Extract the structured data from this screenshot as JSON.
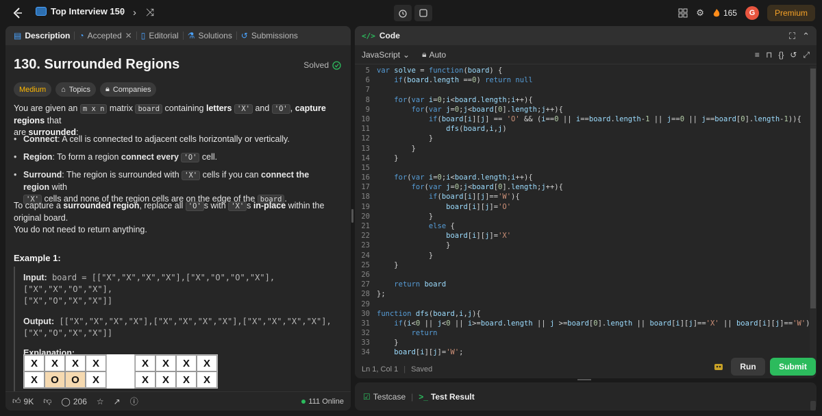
{
  "topbar": {
    "list_title": "Top Interview 150",
    "streak_count": "165",
    "avatar_letter": "G",
    "premium_label": "Premium"
  },
  "left_tabs": [
    {
      "label": "Description"
    },
    {
      "label": "Accepted"
    },
    {
      "label": "Editorial"
    },
    {
      "label": "Solutions"
    },
    {
      "label": "Submissions"
    }
  ],
  "problem": {
    "title": "130. Surrounded Regions",
    "solved_label": "Solved",
    "difficulty": "Medium",
    "topics_label": "Topics",
    "companies_label": "Companies",
    "intro_a": "You are given an ",
    "intro_m": "m x n",
    "intro_b": " matrix ",
    "intro_board": "board",
    "intro_c": " containing ",
    "intro_letters": "letters",
    "intro_x": "'X'",
    "intro_and": " and ",
    "intro_o": "'O'",
    "intro_capture": "capture regions",
    "intro_d": " that",
    "intro_e": "are ",
    "intro_surrounded": "surrounded",
    "bullet1_bold": "Connect",
    "bullet1_text": ": A cell is connected to adjacent cells horizontally or vertically.",
    "bullet2_bold": "Region",
    "bullet2_text_a": ": To form a region ",
    "bullet2_bold2": "connect every",
    "bullet2_code": "'O'",
    "bullet2_text_b": " cell.",
    "bullet3_bold": "Surround",
    "bullet3_text_a": ": The region is surrounded with ",
    "bullet3_code": "'X'",
    "bullet3_text_b": " cells if you can ",
    "bullet3_bold2": "connect the region",
    "bullet3_text_c": " with",
    "bullet3_code2": "'X'",
    "bullet3_text_d": " cells and none of the region cells are on the edge of the ",
    "bullet3_code3": "board",
    "bullet3_text_e": ".",
    "para2_a": "To capture a ",
    "para2_bold": "surrounded region",
    "para2_b": ", replace all ",
    "para2_code": "'O'",
    "para2_c": "s with ",
    "para2_code2": "'X'",
    "para2_d": "s ",
    "para2_bold2": "in-place",
    "para2_e": " within the original board.",
    "para2_f": "You do not need to return anything.",
    "example_title": "Example 1:",
    "input_label": "Input:",
    "input_value_1": " board = [[\"X\",\"X\",\"X\",\"X\"],[\"X\",\"O\",\"O\",\"X\"],[\"X\",\"X\",\"O\",\"X\"],",
    "input_value_2": "[\"X\",\"O\",\"X\",\"X\"]]",
    "output_label": "Output:",
    "output_value_1": " [[\"X\",\"X\",\"X\",\"X\"],[\"X\",\"X\",\"X\",\"X\"],[\"X\",\"X\",\"X\",\"X\"],",
    "output_value_2": "[\"X\",\"O\",\"X\",\"X\"]]",
    "explanation_label": "Explanation:",
    "grid_before": [
      [
        "X",
        "X",
        "X",
        "X"
      ],
      [
        "X",
        "O",
        "O",
        "X"
      ]
    ],
    "grid_after": [
      [
        "X",
        "X",
        "X",
        "X"
      ],
      [
        "X",
        "X",
        "X",
        "X"
      ]
    ]
  },
  "left_footer": {
    "likes": "9K",
    "comments": "206",
    "online": "111 Online"
  },
  "editor": {
    "header_tag": "</>",
    "header_label": "Code",
    "language": "JavaScript",
    "mode": "Auto",
    "status": "Ln 1, Col 1",
    "saved": "Saved",
    "lines": [
      {
        "n": "5",
        "t": "var solve = function(board) {"
      },
      {
        "n": "6",
        "t": "    if(board.length ==0) return null"
      },
      {
        "n": "7",
        "t": ""
      },
      {
        "n": "8",
        "t": "    for(var i=0;i<board.length;i++){"
      },
      {
        "n": "9",
        "t": "        for(var j=0;j<board[0].length;j++){"
      },
      {
        "n": "10",
        "t": "            if(board[i][j] == 'O' && (i==0 || i==board.length-1 || j==0 || j==board[0].length-1)){"
      },
      {
        "n": "11",
        "t": "                dfs(board,i,j)"
      },
      {
        "n": "12",
        "t": "            }"
      },
      {
        "n": "13",
        "t": "        }"
      },
      {
        "n": "14",
        "t": "    }"
      },
      {
        "n": "15",
        "t": ""
      },
      {
        "n": "16",
        "t": "    for(var i=0;i<board.length;i++){"
      },
      {
        "n": "17",
        "t": "        for(var j=0;j<board[0].length;j++){"
      },
      {
        "n": "18",
        "t": "            if(board[i][j]=='W'){"
      },
      {
        "n": "19",
        "t": "                board[i][j]='O'"
      },
      {
        "n": "20",
        "t": "            }"
      },
      {
        "n": "21",
        "t": "            else {"
      },
      {
        "n": "22",
        "t": "                board[i][j]='X'"
      },
      {
        "n": "23",
        "t": "                }"
      },
      {
        "n": "24",
        "t": "            }"
      },
      {
        "n": "25",
        "t": "    }"
      },
      {
        "n": "26",
        "t": ""
      },
      {
        "n": "27",
        "t": "    return board"
      },
      {
        "n": "28",
        "t": "};"
      },
      {
        "n": "29",
        "t": ""
      },
      {
        "n": "30",
        "t": "function dfs(board,i,j){"
      },
      {
        "n": "31",
        "t": "    if(i<0 || j<0 || i>=board.length || j >=board[0].length || board[i][j]=='X' || board[i][j]=='W'){"
      },
      {
        "n": "32",
        "t": "        return"
      },
      {
        "n": "33",
        "t": "    }"
      },
      {
        "n": "34",
        "t": "    board[i][j]='W';"
      }
    ]
  },
  "actions": {
    "run_label": "Run",
    "submit_label": "Submit"
  },
  "test_panel": {
    "testcase_label": "Testcase",
    "result_label": "Test Result"
  },
  "colors": {
    "accent_green": "#2cbb5d",
    "medium": "#ffb800",
    "premium": "#f7a227"
  }
}
